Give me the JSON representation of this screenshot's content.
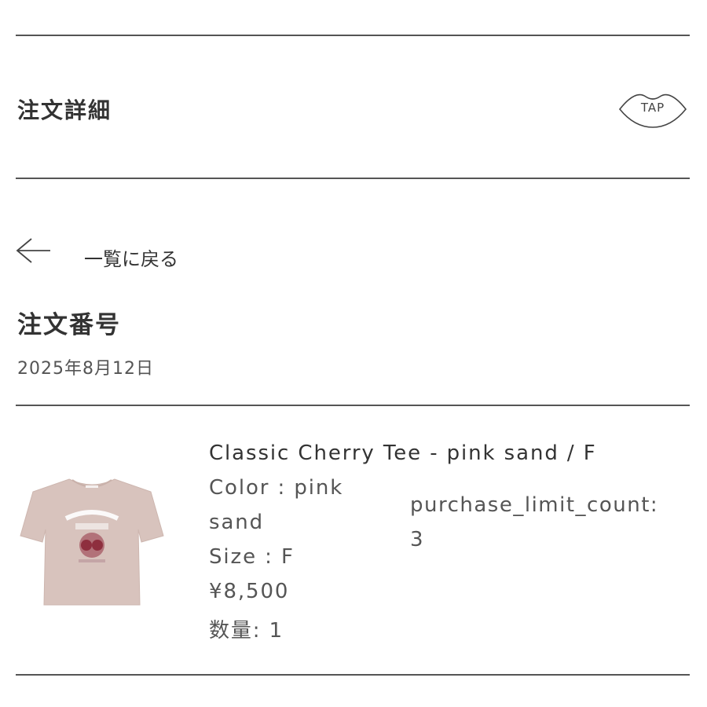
{
  "header": {
    "title": "注文詳細",
    "tap_label": "TAP"
  },
  "navigation": {
    "back_label": "一覧に戻る"
  },
  "order": {
    "heading": "注文番号",
    "date": "2025年8月12日"
  },
  "item": {
    "name": "Classic Cherry Tee - pink sand / F",
    "color_line1": "Color : pink",
    "color_line2": "sand",
    "size": "Size : F",
    "price": "¥8,500",
    "quantity": "数量: 1",
    "limit_label": "purchase_limit_count:",
    "limit_value": "3",
    "image_color": "#d8c3bd"
  },
  "colors": {
    "text": "#333333",
    "rule": "#555555"
  }
}
